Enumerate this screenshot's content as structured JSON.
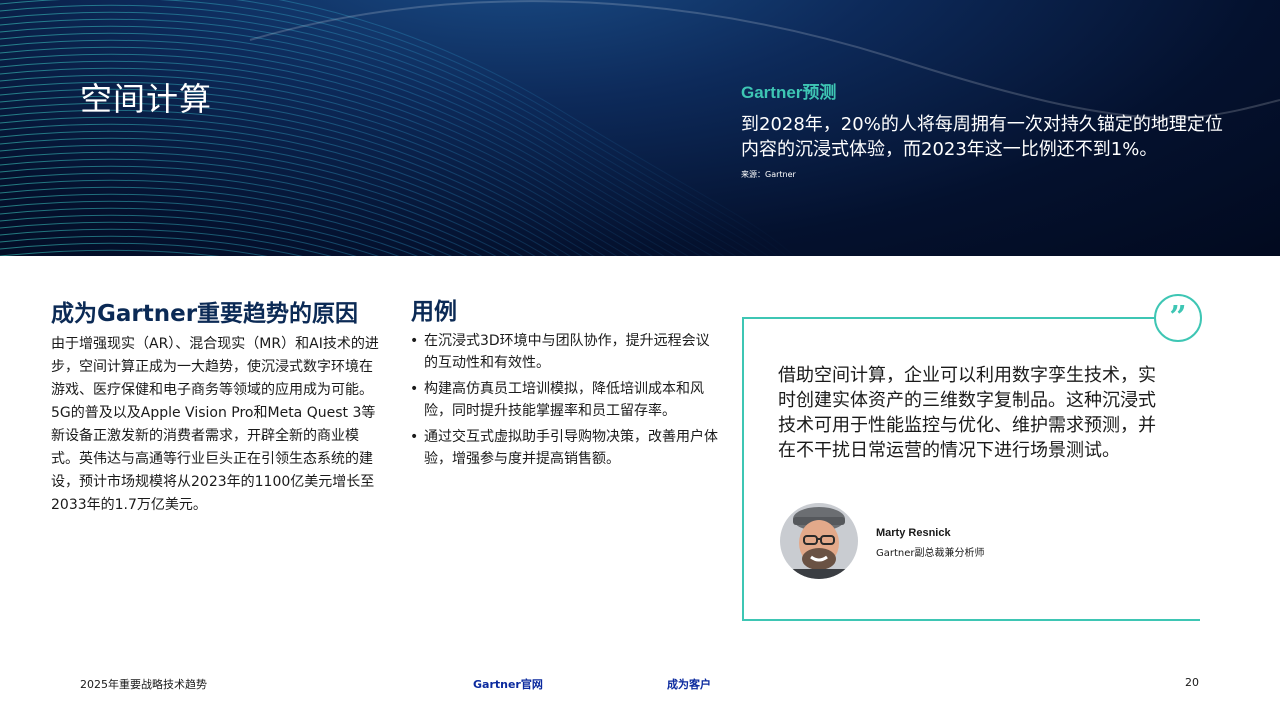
{
  "hero": {
    "title": "空间计算",
    "forecast_label": "Gartner预测",
    "forecast_text": "到2028年，20%的人将每周拥有一次对持久锚定的地理定位内容的沉浸式体验，而2023年这一比例还不到1%。",
    "source": "来源：Gartner"
  },
  "reasons": {
    "title": "成为Gartner重要趋势的原因",
    "body": "由于增强现实（AR）、混合现实（MR）和AI技术的进步，空间计算正成为一大趋势，使沉浸式数字环境在游戏、医疗保健和电子商务等领域的应用成为可能。5G的普及以及Apple Vision Pro和Meta Quest 3等新设备正激发新的消费者需求，开辟全新的商业模式。英伟达与高通等行业巨头正在引领生态系统的建设，预计市场规模将从2023年的1100亿美元增长至2033年的1.7万亿美元。"
  },
  "uses": {
    "title": "用例",
    "items": [
      "在沉浸式3D环境中与团队协作，提升远程会议的互动性和有效性。",
      "构建高仿真员工培训模拟，降低培训成本和风险，同时提升技能掌握率和员工留存率。",
      "通过交互式虚拟助手引导购物决策，改善用户体验，增强参与度并提高销售额。"
    ]
  },
  "quote": {
    "text": "借助空间计算，企业可以利用数字孪生技术，实时创建实体资产的三维数字复制品。这种沉浸式技术可用于性能监控与优化、维护需求预测，并在不干扰日常运营的情况下进行场景测试。",
    "icon": "quote-mark-icon",
    "person_name": "Marty Resnick",
    "person_title": "Gartner副总裁兼分析师"
  },
  "footer": {
    "doc_title": "2025年重要战略技术趋势",
    "link_website": "Gartner官网",
    "link_client": "成为客户",
    "page_number": "20"
  },
  "colors": {
    "accent": "#3ec6b4",
    "heading": "#0b2a55",
    "link": "#0b2a9e",
    "hero_bg": "#04112e"
  }
}
